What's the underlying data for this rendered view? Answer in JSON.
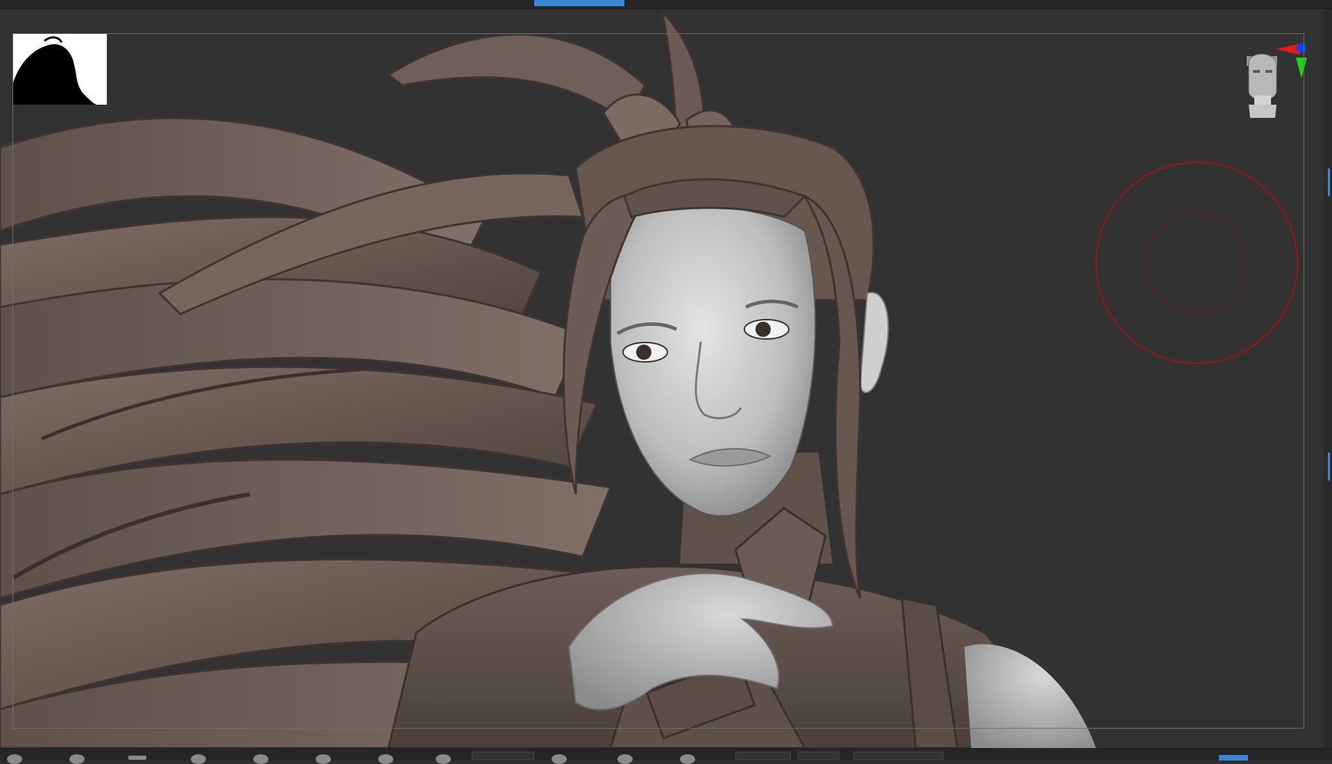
{
  "app": {
    "accent_color": "#3d86d6",
    "viewport_background": "#323232",
    "model_color": "#6e6058",
    "skin_color": "#c9c9c9"
  },
  "viewport": {
    "thumbnail": {
      "icon": "silhouette-icon"
    },
    "gizmo": {
      "icon": "orientation-head-icon",
      "axes": [
        {
          "name": "x",
          "color": "#e21a1a"
        },
        {
          "name": "y",
          "color": "#20d020"
        },
        {
          "name": "z",
          "color": "#1840e8"
        }
      ]
    },
    "brush_cursor": {
      "color": "#9a1515",
      "icon": "brush-cursor-icon"
    }
  },
  "bottom_toolbar": {
    "items": [
      {
        "icon": "sphere-icon"
      },
      {
        "icon": "sphere-icon"
      },
      {
        "icon": "stroke-icon"
      },
      {
        "icon": "sphere-icon"
      },
      {
        "icon": "sphere-icon"
      },
      {
        "icon": "sphere-icon"
      },
      {
        "icon": "sphere-icon"
      },
      {
        "icon": "sphere-icon"
      },
      {
        "icon": "sphere-icon"
      },
      {
        "icon": "sphere-icon"
      },
      {
        "icon": "sphere-icon"
      }
    ]
  }
}
